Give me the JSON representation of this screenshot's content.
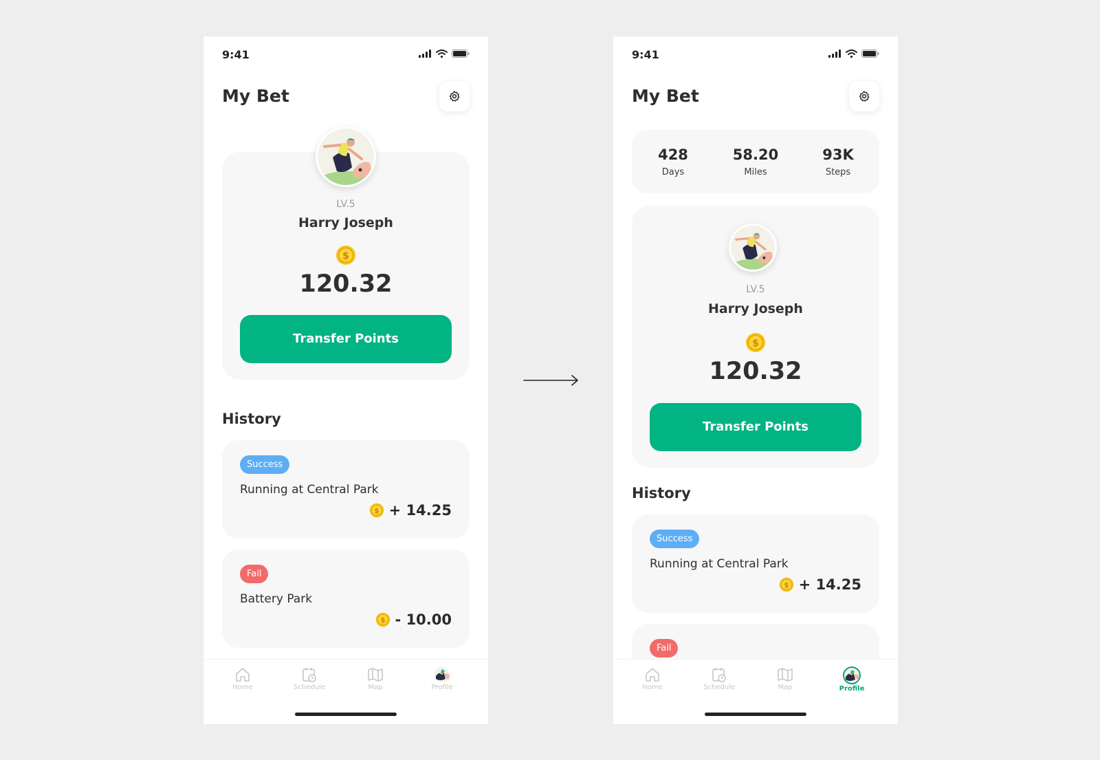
{
  "status_bar": {
    "time": "9:41"
  },
  "header": {
    "title": "My Bet"
  },
  "stats": [
    {
      "value": "428",
      "label": "Days"
    },
    {
      "value": "58.20",
      "label": "Miles"
    },
    {
      "value": "93K",
      "label": "Steps"
    }
  ],
  "profile": {
    "level": "LV.5",
    "name": "Harry Joseph",
    "points": "120.32",
    "transfer_label": "Transfer Points"
  },
  "history": {
    "title": "History",
    "items": [
      {
        "status": "Success",
        "title": "Running at Central Park",
        "amount": "+ 14.25"
      },
      {
        "status": "Fail",
        "title": "Battery Park",
        "amount": "- 10.00"
      }
    ]
  },
  "tabs": [
    {
      "label": "Home",
      "icon": "home-icon"
    },
    {
      "label": "Schedule",
      "icon": "calendar-clock-icon"
    },
    {
      "label": "Map",
      "icon": "map-icon"
    },
    {
      "label": "Profile",
      "icon": "avatar-icon"
    }
  ],
  "colors": {
    "accent": "#02b383",
    "success_badge": "#5eaef5",
    "fail_badge": "#f26a6a",
    "coin": "#f5c518"
  }
}
